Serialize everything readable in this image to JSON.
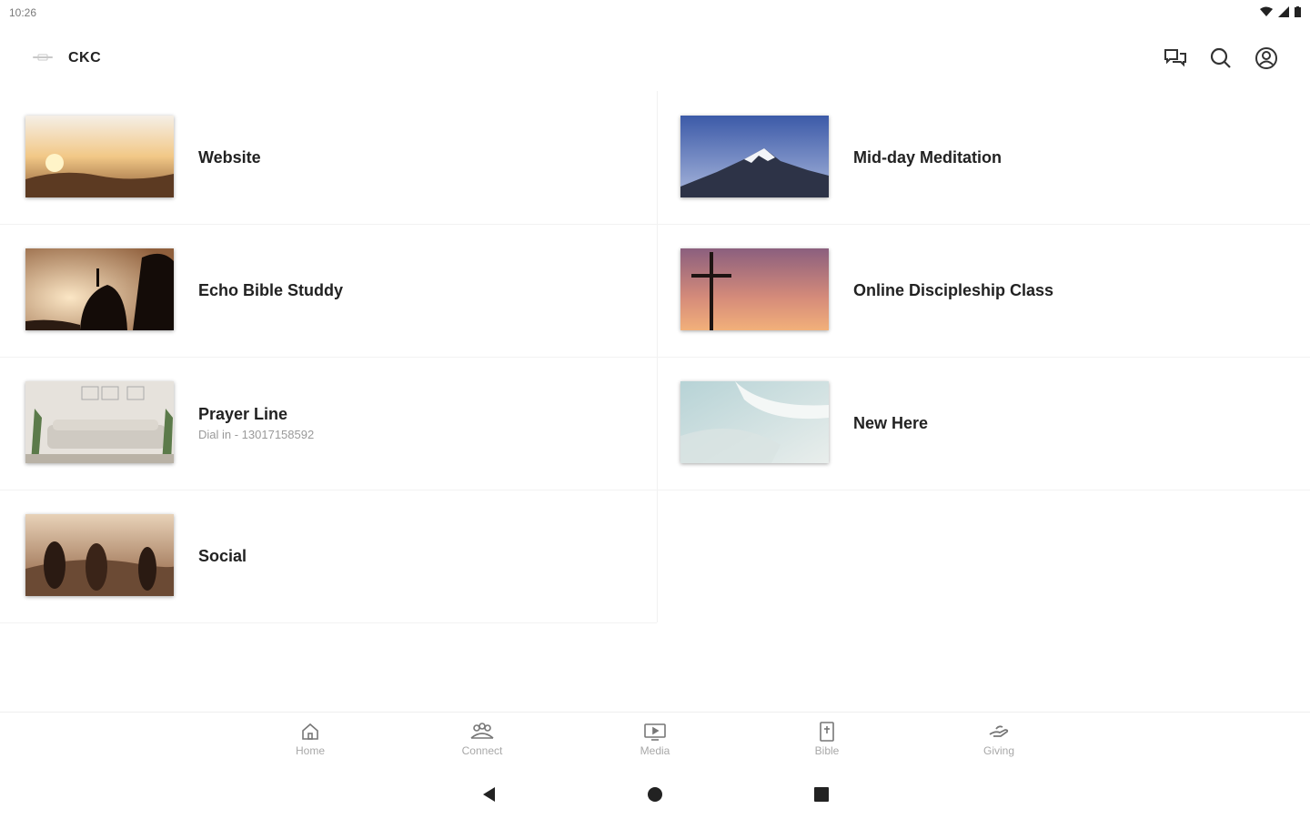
{
  "status_bar": {
    "time": "10:26",
    "icons": [
      "wifi-icon",
      "signal-icon",
      "battery-icon"
    ]
  },
  "header": {
    "title": "CKC",
    "actions": [
      "chat-icon",
      "search-icon",
      "account-icon"
    ]
  },
  "cards": [
    {
      "title": "Website",
      "subtitle": "",
      "image": "sunset-over-hills"
    },
    {
      "title": "Mid-day Meditation",
      "subtitle": "",
      "image": "snowy-mountain"
    },
    {
      "title": "Echo Bible Studdy",
      "subtitle": "",
      "image": "person-on-rock-silhouette"
    },
    {
      "title": "Online Discipleship Class",
      "subtitle": "",
      "image": "cross-at-dusk"
    },
    {
      "title": "Prayer Line",
      "subtitle": "Dial in - 13017158592",
      "image": "living-room"
    },
    {
      "title": "New Here",
      "subtitle": "",
      "image": "ocean-waves"
    },
    {
      "title": "Social",
      "subtitle": "",
      "image": "friends-at-sunset"
    }
  ],
  "bottom_nav": [
    {
      "label": "Home",
      "icon": "home-icon"
    },
    {
      "label": "Connect",
      "icon": "group-icon"
    },
    {
      "label": "Media",
      "icon": "tv-icon"
    },
    {
      "label": "Bible",
      "icon": "bible-icon"
    },
    {
      "label": "Giving",
      "icon": "giving-hand-icon"
    }
  ],
  "system_nav": [
    "back-button",
    "home-button",
    "recents-button"
  ],
  "colors": {
    "text": "#222222",
    "muted": "#a8a8a8",
    "divider": "#f1f1f1"
  }
}
